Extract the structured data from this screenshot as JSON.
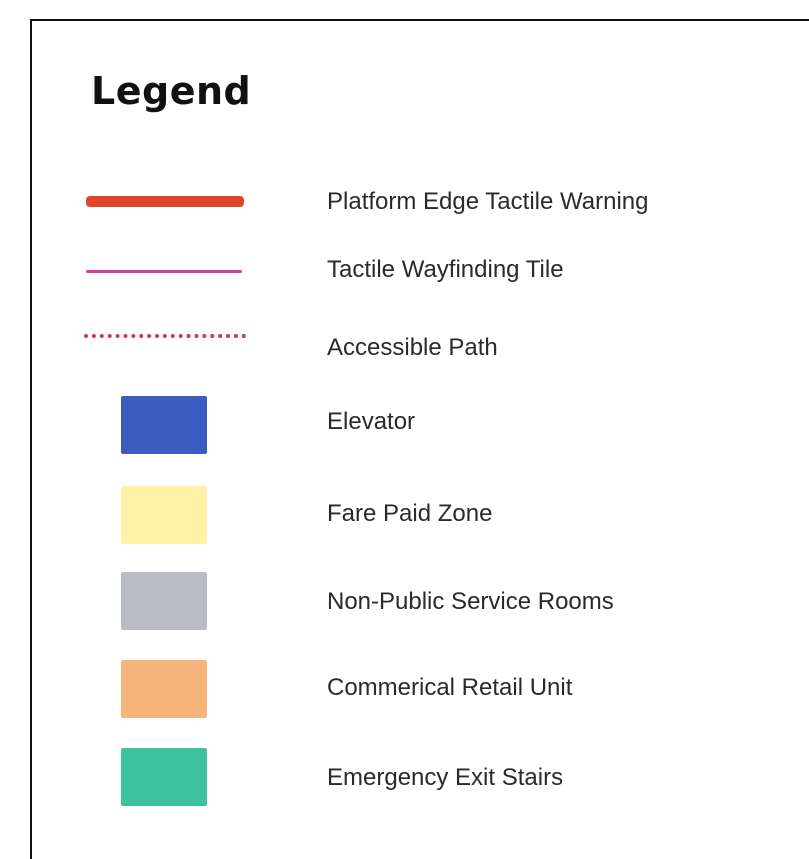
{
  "legend": {
    "title": "Legend",
    "items": [
      {
        "label": "Platform Edge Tactile Warning",
        "symbol": "thick-line",
        "color": "#e0452b"
      },
      {
        "label": "Tactile Wayfinding Tile",
        "symbol": "thin-line",
        "color": "#d23d9c"
      },
      {
        "label": "Accessible Path",
        "symbol": "dotted-line",
        "color": "#c8327a"
      },
      {
        "label": "Elevator",
        "symbol": "swatch",
        "color": "#3d5cc0"
      },
      {
        "label": "Fare Paid Zone",
        "symbol": "swatch",
        "color": "#fff2a6"
      },
      {
        "label": "Non-Public Service Rooms",
        "symbol": "swatch",
        "color": "#b9bcc4"
      },
      {
        "label": "Commerical Retail Unit",
        "symbol": "swatch",
        "color": "#f5b57a"
      },
      {
        "label": "Emergency Exit Stairs",
        "symbol": "swatch",
        "color": "#3fc29e"
      }
    ]
  }
}
